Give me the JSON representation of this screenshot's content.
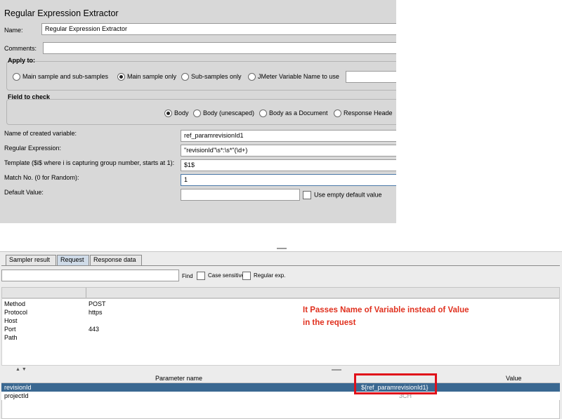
{
  "extractor": {
    "title": "Regular Expression Extractor",
    "name_label": "Name:",
    "name_value": "Regular Expression Extractor",
    "comments_label": "Comments:",
    "comments_value": "",
    "apply_to": {
      "label": "Apply to:",
      "options": [
        "Main sample and sub-samples",
        "Main sample only",
        "Sub-samples only",
        "JMeter Variable Name to use"
      ],
      "selected": "Main sample only",
      "variable_value": ""
    },
    "field_to_check": {
      "label": "Field to check",
      "options": [
        "Body",
        "Body (unescaped)",
        "Body as a Document",
        "Response Heade"
      ],
      "selected": "Body"
    },
    "created_variable_label": "Name of created variable:",
    "created_variable_value": "ref_paramrevisionId1",
    "regex_label": "Regular Expression:",
    "regex_value": "\"revisionId\"\\s*:\\s*\"(\\d+)",
    "template_label": "Template ($i$ where i is capturing group number, starts at 1):",
    "template_value": "$1$",
    "match_label": "Match No. (0 for Random):",
    "match_value": "1",
    "default_label": "Default Value:",
    "default_value": "",
    "use_empty_label": "Use empty default value"
  },
  "results": {
    "tabs": [
      "Sampler result",
      "Request",
      "Response data"
    ],
    "active_tab": "Request",
    "search_value": "",
    "find_label": "Find",
    "case_sensitive_label": "Case sensitive",
    "regular_exp_label": "Regular exp.",
    "request_rows": [
      {
        "key": "Method",
        "value": "POST"
      },
      {
        "key": "Protocol",
        "value": "https"
      },
      {
        "key": "Host",
        "value": ""
      },
      {
        "key": "Port",
        "value": "443"
      },
      {
        "key": "Path",
        "value": ""
      }
    ],
    "annotation_line1": "It Passes Name of Variable instead of Value",
    "annotation_line2": "in the request",
    "param_header_name": "Parameter name",
    "param_header_value": "Value",
    "params": [
      {
        "name": "revisionId",
        "value": "${ref_paramrevisionId1}"
      },
      {
        "name": "projectId",
        "value": "3CH"
      }
    ],
    "colors": {
      "selected_row": "#3a6891",
      "annotation": "#e0301e",
      "highlight_box": "#e0101a"
    }
  }
}
